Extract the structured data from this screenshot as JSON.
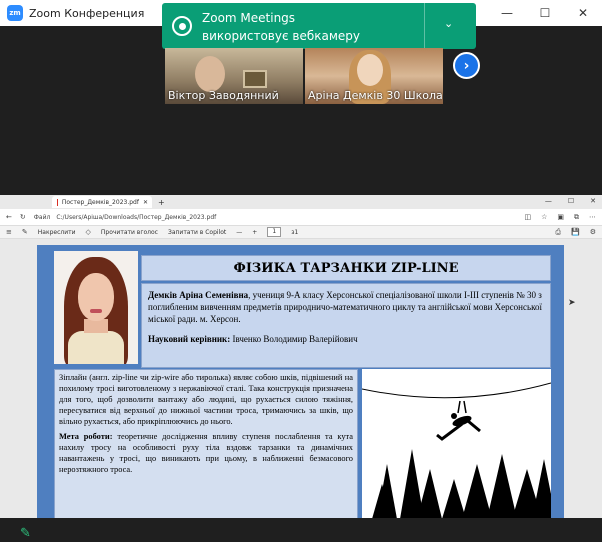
{
  "window": {
    "logo_text": "zm",
    "title": "Zoom Конференция",
    "controls": {
      "minimize": "—",
      "maximize": "☐",
      "close": "✕"
    }
  },
  "notification": {
    "title": "Zoom Meetings",
    "subtitle": "використовує вебкамеру",
    "chevron": "⌄"
  },
  "participants": [
    {
      "name": "Віктор Заводянний"
    },
    {
      "name": "Аріна Демків 30 Школа"
    }
  ],
  "next_arrow": "›",
  "browser": {
    "tab_title": "Постер_Демків_2023.pdf",
    "tab_close": "✕",
    "new_tab": "+",
    "url_label": "Файл",
    "url": "C:/Users/Аріша/Downloads/Постер_Демків_2023.pdf",
    "pdf_toolbar": {
      "draw": "Накреслити",
      "read_aloud": "Прочитати вголос",
      "copilot": "Запитати в Copilot",
      "minus": "—",
      "plus": "+",
      "page": "1",
      "page_of": "з1"
    }
  },
  "poster": {
    "title": "ФІЗИКА ТАРЗАНКИ ZIP-LINE",
    "author_name": "Демків Аріна Семенівна",
    "author_text": ", учениця 9-А класу Херсонської спеціалізованої школи І-ІІІ ступенів № 30 з поглибленим вивченням предметів природничо-математичного циклу та англійської мови Херсонської міської ради. м. Херсон.",
    "supervisor_label": "Науковий керівник:",
    "supervisor_name": " Івченко Володимир Валерійович",
    "intro": "Зіплайн (англ. zip-line чи zip-wire або тиролька) являє собою шків, підвішений на похилому тросі виготовленому з нержавіючої сталі. Така конструкція призначена для того, щоб дозволити вантажу або людині, що рухається силою тяжіння, пересуватися від верхньої до нижньої частини троса, тримаючись за шків, що вільно рухається, або прикріплюючись до нього.",
    "goal_label": "Мета роботи:",
    "goal_text": " теоретичне дослідження впливу ступеня послаблення та кута нахилу тросу на особливості руху тіла вздовж тарзанки та динамічних навантажень у тросі, що виникають при цьому, в наближенні безмасового нерозтяжного троса."
  },
  "colors": {
    "zoom_blue": "#2d8cff",
    "notification_green": "#0a9e76",
    "poster_blue": "#4f7fc0",
    "panel_light": "#c7d6ee"
  }
}
